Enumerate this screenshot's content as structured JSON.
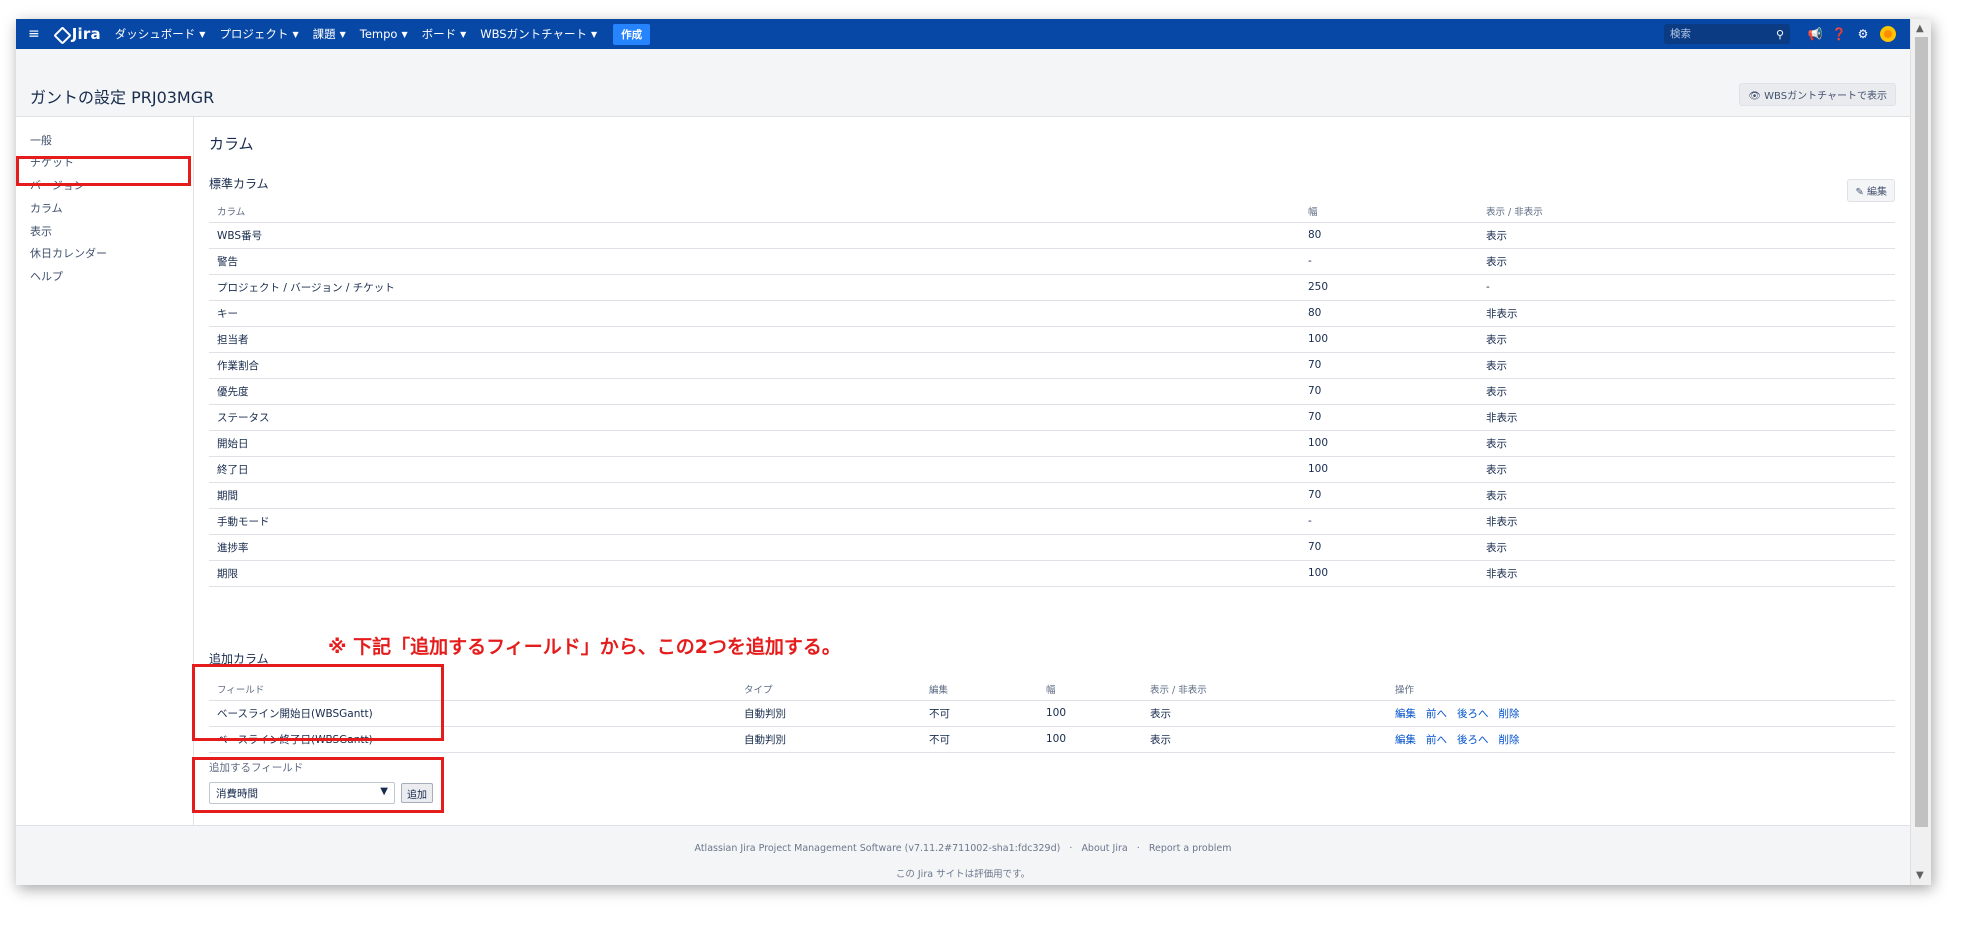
{
  "nav": {
    "logo": "Jira",
    "items": [
      "ダッシュボード",
      "プロジェクト",
      "課題",
      "Tempo",
      "ボード",
      "WBSガントチャート"
    ],
    "create": "作成",
    "search_placeholder": "検索"
  },
  "header": {
    "title": "ガントの設定 PRJ03MGR",
    "view_button": "WBSガントチャートで表示"
  },
  "sidebar": {
    "items": [
      "一般",
      "チケット",
      "バージョン",
      "カラム",
      "表示",
      "休日カレンダー",
      "ヘルプ"
    ]
  },
  "main": {
    "title": "カラム",
    "standard_title": "標準カラム",
    "edit_label": "編集",
    "standard_headers": [
      "カラム",
      "幅",
      "表示 / 非表示"
    ],
    "standard_rows": [
      [
        "WBS番号",
        "80",
        "表示"
      ],
      [
        "警告",
        "-",
        "表示"
      ],
      [
        "プロジェクト / バージョン / チケット",
        "250",
        "-"
      ],
      [
        "キー",
        "80",
        "非表示"
      ],
      [
        "担当者",
        "100",
        "表示"
      ],
      [
        "作業割合",
        "70",
        "表示"
      ],
      [
        "優先度",
        "70",
        "表示"
      ],
      [
        "ステータス",
        "70",
        "非表示"
      ],
      [
        "開始日",
        "100",
        "表示"
      ],
      [
        "終了日",
        "100",
        "表示"
      ],
      [
        "期間",
        "70",
        "表示"
      ],
      [
        "手動モード",
        "-",
        "非表示"
      ],
      [
        "進捗率",
        "70",
        "表示"
      ],
      [
        "期限",
        "100",
        "非表示"
      ]
    ],
    "annotation": "※ 下記「追加するフィールド」から、この2つを追加する。",
    "extra_title": "追加カラム",
    "extra_headers": [
      "フィールド",
      "タイプ",
      "編集",
      "幅",
      "表示 / 非表示",
      "操作"
    ],
    "extra_rows": [
      [
        "ベースライン開始日(WBSGantt)",
        "自動判別",
        "不可",
        "100",
        "表示"
      ],
      [
        "ベースライン終了日(WBSGantt)",
        "自動判別",
        "不可",
        "100",
        "表示"
      ]
    ],
    "ops": [
      "編集",
      "前へ",
      "後ろへ",
      "削除"
    ],
    "add_field_label": "追加するフィールド",
    "add_field_value": "消費時間",
    "add_button": "追加"
  },
  "footer": {
    "line1": "Atlassian Jira Project Management Software (v7.11.2#711002-sha1:fdc329d)",
    "about": "About Jira",
    "report": "Report a problem",
    "line2": "この Jira サイトは評価用です。"
  }
}
